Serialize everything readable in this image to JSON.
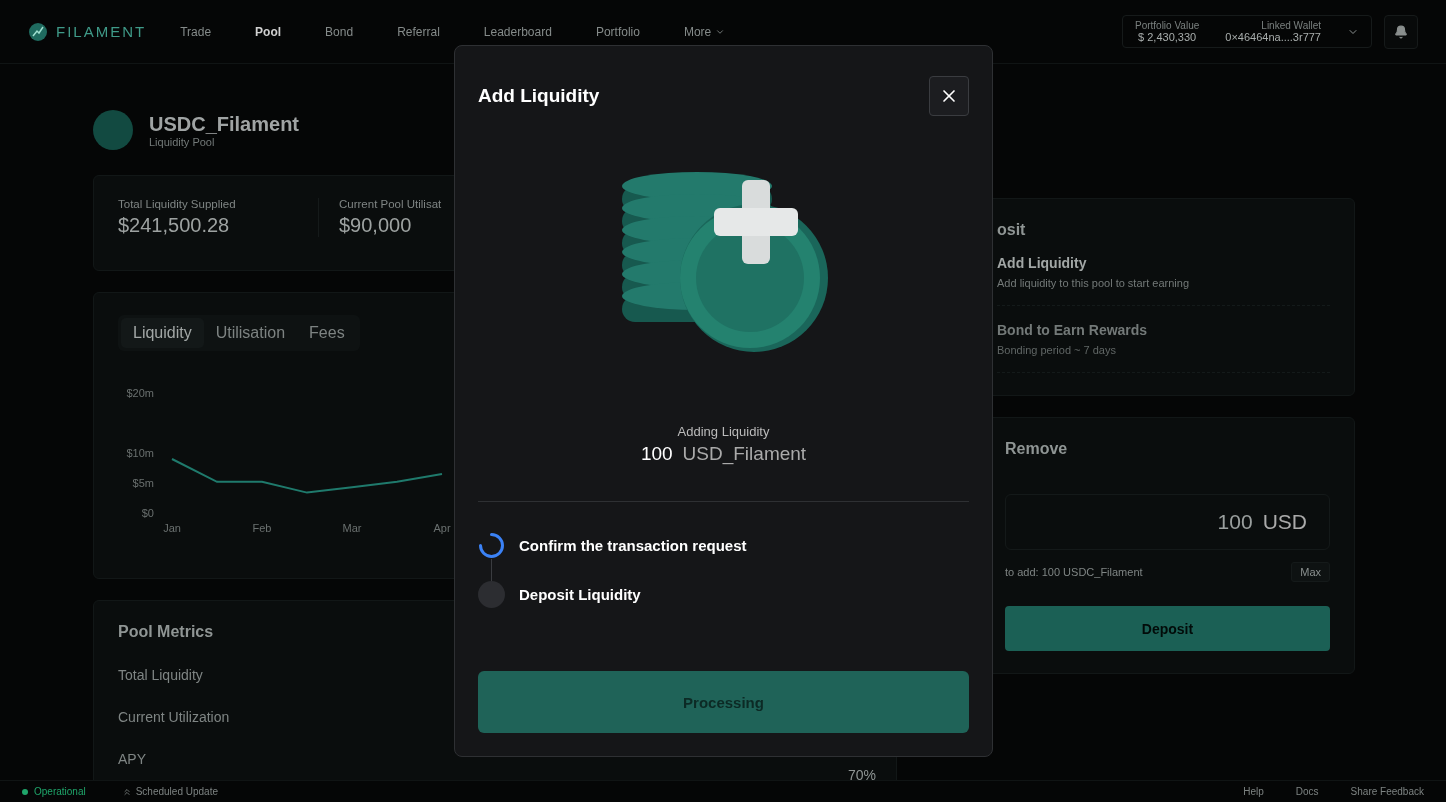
{
  "nav": {
    "logo": "FILAMENT",
    "items": [
      {
        "label": "Trade",
        "selected": false
      },
      {
        "label": "Pool",
        "selected": true
      },
      {
        "label": "Bond",
        "selected": false
      },
      {
        "label": "Referral",
        "selected": false
      },
      {
        "label": "Leaderboard",
        "selected": false
      },
      {
        "label": "Portfolio",
        "selected": false
      },
      {
        "label": "More",
        "selected": false
      }
    ],
    "portfolio_label": "Portfolio Value",
    "portfolio_value": "$ 2,430,330",
    "wallet_label": "Linked Wallet",
    "wallet_value": "0×46464na....3r777"
  },
  "pool": {
    "name": "USDC_Filament",
    "subtitle": "Liquidity Pool"
  },
  "stats": [
    {
      "label": "Total Liquidity Supplied",
      "value": "$241,500.28"
    },
    {
      "label": "Current Pool Utilisat",
      "value": "$90,000"
    }
  ],
  "chart_tabs": [
    {
      "label": "Liquidity",
      "selected": true
    },
    {
      "label": "Utilisation",
      "selected": false
    },
    {
      "label": "Fees",
      "selected": false
    }
  ],
  "chart_data": {
    "type": "line",
    "categories": [
      "Jan",
      null,
      "Feb",
      null,
      "Mar",
      null,
      "Apr"
    ],
    "yticks": [
      {
        "value": 0,
        "label": "$0"
      },
      {
        "value": 5,
        "label": "$5m"
      },
      {
        "value": 10,
        "label": "$10m"
      },
      {
        "value": 20,
        "label": "$20m"
      }
    ],
    "ylim": [
      0,
      20
    ],
    "series": [
      {
        "color": "#1f7a6c",
        "values": [
          9,
          5.2,
          5.2,
          3.4,
          4.3,
          5.2,
          6.5
        ]
      }
    ]
  },
  "metrics": {
    "title": "Pool Metrics",
    "rows": [
      {
        "label": "Total Liquidity"
      },
      {
        "label": "Current Utilization"
      },
      {
        "label": "APY",
        "value": "70%"
      }
    ]
  },
  "deposit": {
    "title": "osit",
    "options": [
      {
        "title": "Add Liquidity",
        "subtitle": "Add liquidity to this pool to start earning",
        "selected": true
      },
      {
        "title": "Bond to Earn Rewards",
        "subtitle": "Bonding period ~ 7 days",
        "selected": false
      }
    ]
  },
  "remove": {
    "title": "Remove",
    "amount": "100",
    "unit": "USD",
    "hint_label": "to add:",
    "hint_value": "100 USDC_Filament",
    "max": "Max",
    "button": "Deposit"
  },
  "modal": {
    "title": "Add Liquidity",
    "caption": "Adding Liquidity",
    "amount": "100",
    "token": "USD_Filament",
    "steps": [
      {
        "label": "Confirm the transaction request",
        "in_progress": true
      },
      {
        "label": "Deposit Liquidity",
        "in_progress": false
      }
    ],
    "button": "Processing"
  },
  "footer": {
    "status": "Operational",
    "update": "Scheduled Update",
    "links": [
      "Help",
      "Docs",
      "Share Feedback"
    ]
  }
}
